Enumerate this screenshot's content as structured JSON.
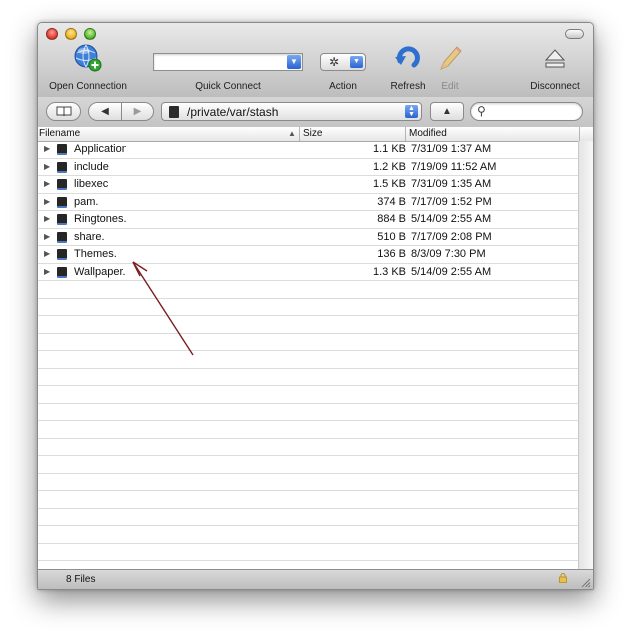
{
  "toolbar": {
    "open_connection": "Open Connection",
    "quick_connect": "Quick Connect",
    "action": "Action",
    "refresh": "Refresh",
    "edit": "Edit",
    "disconnect": "Disconnect"
  },
  "nav": {
    "path": "/private/var/stash",
    "search_placeholder": ""
  },
  "columns": {
    "filename": "Filename",
    "size": "Size",
    "modified": "Modified"
  },
  "files": [
    {
      "name": "Applications.",
      "size": "1.1 KB",
      "modified": "7/31/09 1:37 AM"
    },
    {
      "name": "include.",
      "size": "1.2 KB",
      "modified": "7/19/09 11:52 AM"
    },
    {
      "name": "libexec",
      "size": "1.5 KB",
      "modified": "7/31/09 1:35 AM"
    },
    {
      "name": "pam.",
      "size": "374 B",
      "modified": "7/17/09 1:52 PM"
    },
    {
      "name": "Ringtones.",
      "size": "884 B",
      "modified": "5/14/09 2:55 AM"
    },
    {
      "name": "share.",
      "size": "510 B",
      "modified": "7/17/09 2:08 PM"
    },
    {
      "name": "Themes.",
      "size": "136 B",
      "modified": "8/3/09 7:30 PM"
    },
    {
      "name": "Wallpaper.",
      "size": "1.3 KB",
      "modified": "5/14/09 2:55 AM"
    }
  ],
  "status": {
    "count": "8 Files"
  },
  "colors": {
    "accent_blue": "#2a63d3",
    "annotation_arrow": "#7a1f1f"
  },
  "icons": [
    "globe-plus-icon",
    "gear-icon",
    "refresh-icon",
    "pencil-icon",
    "eject-icon",
    "book-icon",
    "back-icon",
    "forward-icon",
    "disk-icon",
    "up-icon",
    "search-icon",
    "lock-icon",
    "resize-grip-icon"
  ]
}
